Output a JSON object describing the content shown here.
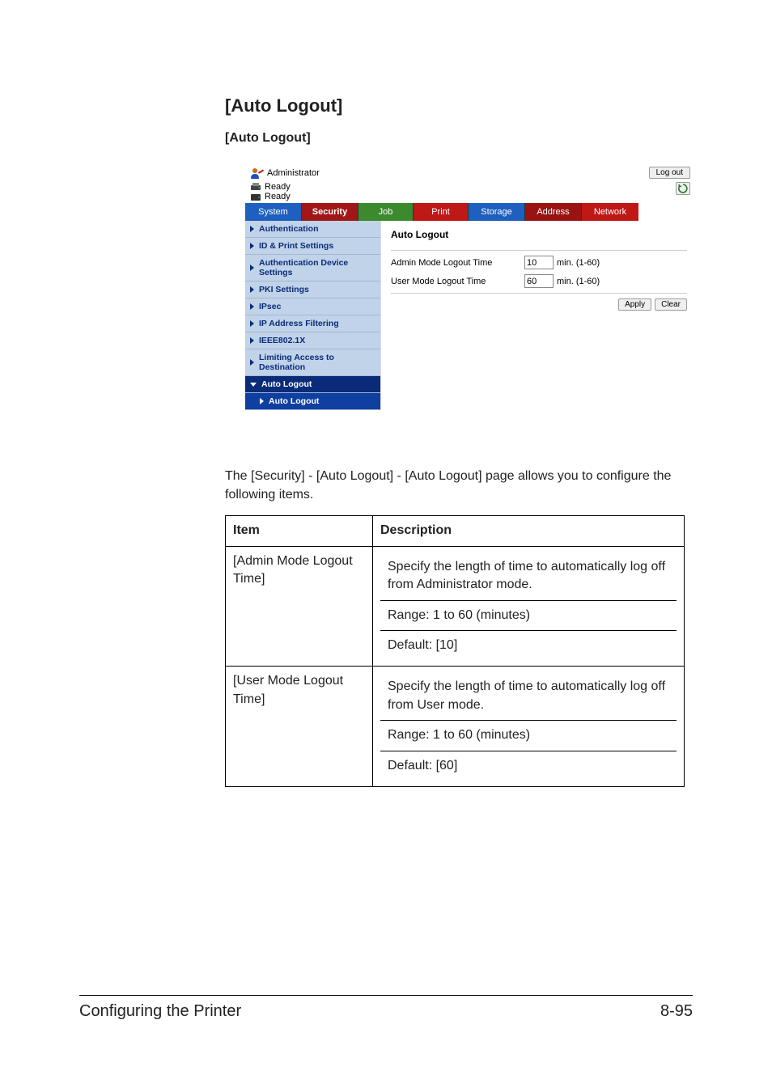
{
  "section_heading": "[Auto Logout]",
  "sub_heading": "[Auto Logout]",
  "app": {
    "admin_label": "Administrator",
    "logout_button": "Log out",
    "status1": "Ready",
    "status2": "Ready",
    "tabs": {
      "system": "System",
      "security": "Security",
      "job": "Job",
      "print": "Print",
      "storage": "Storage",
      "address": "Address",
      "network": "Network"
    },
    "sidebar": {
      "authentication": "Authentication",
      "id_print": "ID & Print Settings",
      "auth_device": "Authentication Device Settings",
      "pki": "PKI Settings",
      "ipsec": "IPsec",
      "ip_filter": "IP Address Filtering",
      "ieee": "IEEE802.1X",
      "limit_dest": "Limiting Access to Destination",
      "auto_logout_section": "Auto Logout",
      "auto_logout_item": "Auto Logout"
    },
    "content": {
      "title": "Auto Logout",
      "admin_label": "Admin Mode Logout Time",
      "admin_value": "10",
      "user_label": "User Mode Logout Time",
      "user_value": "60",
      "unit": "min. (1-60)",
      "apply": "Apply",
      "clear": "Clear"
    }
  },
  "description": "The [Security] - [Auto Logout] - [Auto Logout] page allows you to configure the following items.",
  "table": {
    "header_item": "Item",
    "header_desc": "Description",
    "rows": [
      {
        "item": "[Admin Mode Logout Time]",
        "desc1": "Specify the length of time to automatically log off from Administrator mode.",
        "desc2": "Range: 1 to 60 (minutes)",
        "desc3": "Default: [10]"
      },
      {
        "item": "[User Mode Logout Time]",
        "desc1": "Specify the length of time to automatically log off from User mode.",
        "desc2": "Range: 1 to 60 (minutes)",
        "desc3": "Default: [60]"
      }
    ]
  },
  "footer": {
    "left": "Configuring the Printer",
    "right": "8-95"
  }
}
